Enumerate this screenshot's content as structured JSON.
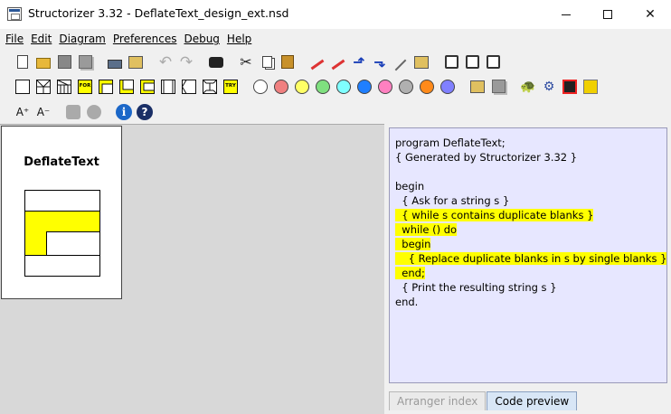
{
  "window": {
    "title": "Structorizer 3.32 - DeflateText_design_ext.nsd"
  },
  "menu": [
    "File",
    "Edit",
    "Diagram",
    "Preferences",
    "Debug",
    "Help"
  ],
  "toolbar_shape_labels": {
    "for": "FOR",
    "try": "TRY"
  },
  "colors": [
    "#ffffff",
    "#f08080",
    "#ffff66",
    "#7fe07f",
    "#7fffff",
    "#1f7fff",
    "#ff80c0",
    "#b0b0b0",
    "#ff8a1a",
    "#8080ff"
  ],
  "diagram": {
    "title": "DeflateText"
  },
  "code": {
    "lines": [
      "program DeflateText;",
      "{ Generated by Structorizer 3.32 }",
      "",
      "begin",
      "  { Ask for a string s }",
      "  { while s contains duplicate blanks }",
      "  while () do",
      "  begin",
      "    { Replace duplicate blanks in s by single blanks }",
      "  end;",
      "  { Print the resulting string s }",
      "end."
    ],
    "highlighted": [
      5,
      6,
      7,
      8,
      9
    ]
  },
  "tabs": {
    "arranger": "Arranger index",
    "preview": "Code preview"
  }
}
